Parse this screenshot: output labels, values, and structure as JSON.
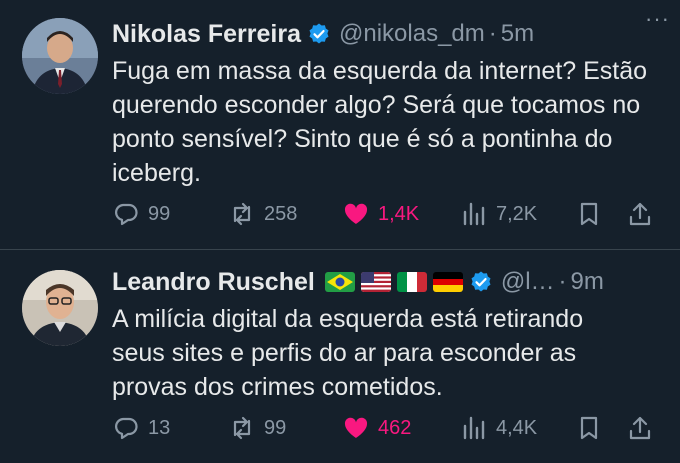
{
  "tweets": [
    {
      "author": "Nikolas Ferreira",
      "handle": "@nikolas_dm",
      "separator": "·",
      "time": "5m",
      "text": "Fuga em massa da esquerda da internet? Estão\nquerendo esconder algo? Será que tocamos no\nponto sensível? Sinto que é só a pontinha do\niceberg.",
      "replies": "99",
      "retweets": "258",
      "likes": "1,4K",
      "views": "7,2K",
      "liked": true
    },
    {
      "author": "Leandro Ruschel",
      "handle": "@l…",
      "separator": "·",
      "time": "9m",
      "flags": [
        "brazil-flag",
        "usa-flag",
        "italy-flag",
        "germany-flag"
      ],
      "text": "A milícia digital da esquerda está retirando\nseus sites e perfis do ar para esconder as\nprovas dos crimes cometidos.",
      "replies": "13",
      "retweets": "99",
      "likes": "462",
      "views": "4,4K",
      "liked": true
    }
  ],
  "more_glyph": "···",
  "colors": {
    "background": "#15202b",
    "text": "#e7e9ea",
    "muted": "#8b98a5",
    "like": "#f91880",
    "verified": "#1d9bf0"
  }
}
